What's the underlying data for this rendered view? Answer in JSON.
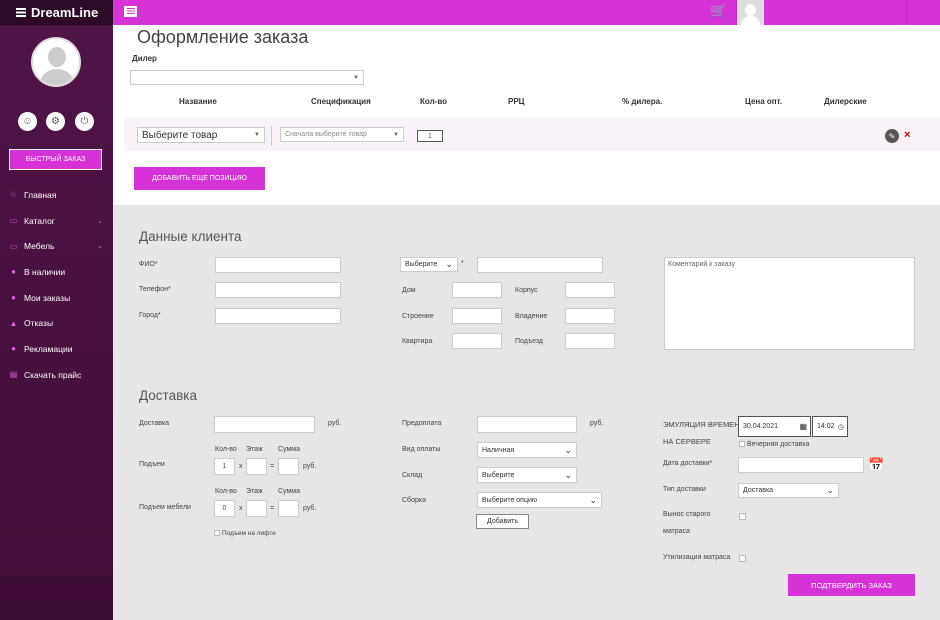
{
  "brand": "DreamLine",
  "sidebar": {
    "quick_order": "БЫСТРЫЙ ЗАКАЗ",
    "items": [
      {
        "label": "Главная",
        "icon": "star-icon",
        "chev": false
      },
      {
        "label": "Каталог",
        "icon": "folder-icon",
        "chev": true
      },
      {
        "label": "Мебель",
        "icon": "folder-icon",
        "chev": true
      },
      {
        "label": "В наличии",
        "icon": "info-icon",
        "chev": false
      },
      {
        "label": "Мои заказы",
        "icon": "cart-circle-icon",
        "chev": false
      },
      {
        "label": "Отказы",
        "icon": "warning-icon",
        "chev": false
      },
      {
        "label": "Рекламации",
        "icon": "info-icon",
        "chev": false
      },
      {
        "label": "Скачать прайс",
        "icon": "document-icon",
        "chev": false
      }
    ]
  },
  "page": {
    "title": "Оформление заказа",
    "dealer_label": "Дилер",
    "dealer_value": ""
  },
  "columns": [
    "Название",
    "Спецификация",
    "Кол-во",
    "РРЦ",
    "% дилера.",
    "Цена опт.",
    "Дилерские"
  ],
  "product_row": {
    "product_select": "Выберите товар",
    "spec_select": "Сначала выберите товар",
    "qty": "1"
  },
  "add_position": "ДОБАВИТЬ ЕЩЕ ПОЗИЦИЮ",
  "client": {
    "title": "Данные клиента",
    "fio": "ФИО*",
    "phone": "Телефон*",
    "city": "Город*",
    "street_select": "Выберите",
    "house": "Дом",
    "korpus": "Корпус",
    "stroenie": "Строение",
    "vladenie": "Владение",
    "kvartira": "Квартира",
    "podezd": "Подъезд",
    "comment_placeholder": "Коментарий к заказу"
  },
  "delivery": {
    "title": "Доставка",
    "delivery_label": "Доставка",
    "rub": "руб.",
    "lift_label": "Подъем",
    "furniture_lift_label": "Подъем мебели",
    "qty_h": "Кол-во",
    "floor_h": "Этаж",
    "sum_h": "Сумма",
    "lift_qty": "1",
    "furniture_qty": "0",
    "x": "x",
    "eq": "=",
    "elevator": "Подъем на лифте",
    "prepay": "Предоплата",
    "pay_type": "Вид оплаты",
    "pay_type_value": "Наличная",
    "warehouse": "Склад",
    "warehouse_value": "Выберите",
    "assembly": "Сборка",
    "assembly_value": "Выберите опцию",
    "add_btn": "Добавить",
    "emulation": "ЭМУЛЯЦИЯ ВРЕМЕНИ",
    "on_server": "НА СЕРВЕРЕ",
    "date_value": "30.04.2021",
    "time_value": "14:02",
    "evening": "Вечерняя доставка",
    "delivery_date": "Дата доставки*",
    "delivery_type": "Тип доставки",
    "delivery_type_value": "Доставка",
    "old_mattress_1": "Вынос старого",
    "old_mattress_2": "матраса",
    "utilization": "Утилизация матраса",
    "confirm": "ПОДТВЕРДИТЬ ЗАКАЗ"
  }
}
